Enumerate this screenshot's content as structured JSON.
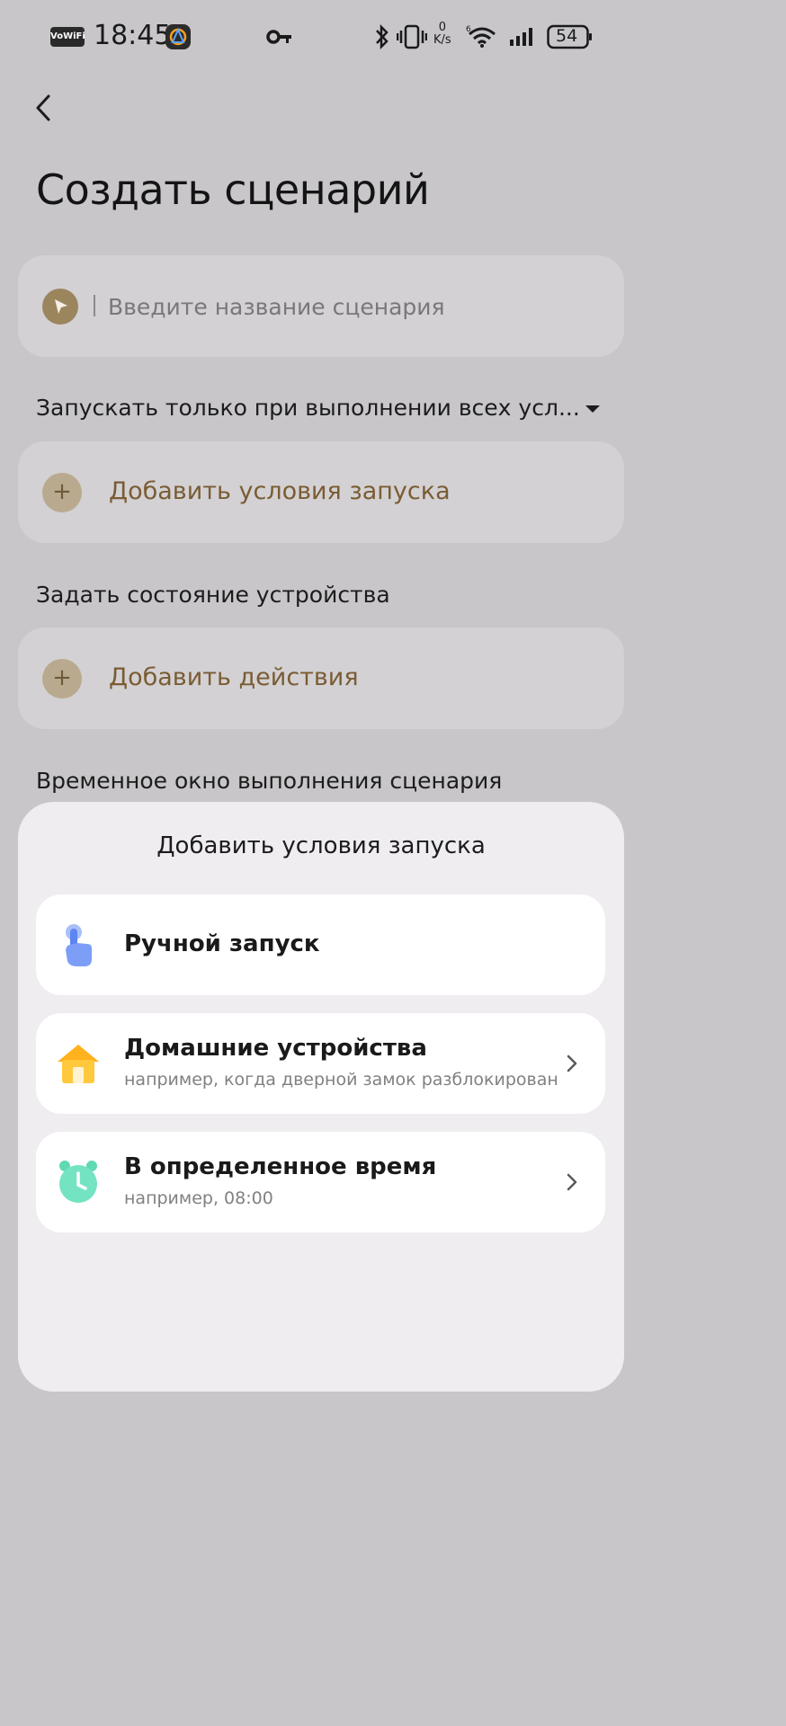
{
  "status_bar": {
    "vowifi": "VoWiFi",
    "time": "18:45",
    "speed_value": "0",
    "speed_unit": "K/s",
    "battery": "54",
    "icons": [
      "key-icon",
      "bluetooth-icon",
      "vibrate-icon",
      "wifi-icon",
      "signal-icon",
      "battery-icon"
    ]
  },
  "header": {
    "title": "Создать сценарий"
  },
  "name_field": {
    "placeholder": "Введите название сценария"
  },
  "conditions": {
    "mode_label": "Запускать только при выполнении всех усл...",
    "add_label": "Добавить условия запуска"
  },
  "actions": {
    "section_label": "Задать состояние устройства",
    "add_label": "Добавить действия"
  },
  "time_window": {
    "section_label": "Временное окно выполнения сценария"
  },
  "sheet": {
    "title": "Добавить условия запуска",
    "options": [
      {
        "title": "Ручной запуск",
        "icon": "tap-hand-icon"
      },
      {
        "title": "Домашние устройства",
        "subtitle": "например, когда дверной замок разблокирован",
        "icon": "home-icon"
      },
      {
        "title": "В определенное время",
        "subtitle": "например, 08:00",
        "icon": "alarm-clock-icon"
      }
    ]
  },
  "colors": {
    "background": "#c8c6c9",
    "card": "#d3d1d4",
    "accent_text": "#7a5c33",
    "sheet": "#efedf0"
  }
}
